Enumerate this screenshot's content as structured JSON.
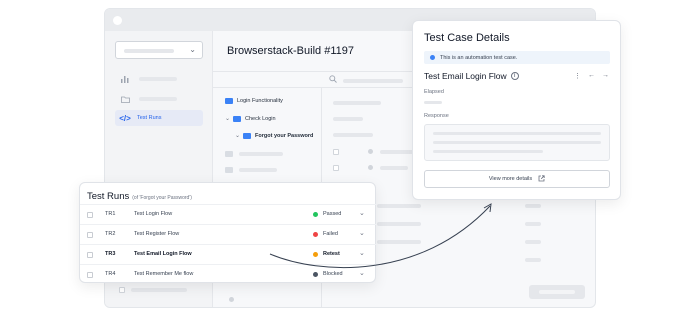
{
  "app": {
    "build_title": "Browserstack-Build #1197",
    "nav": [
      {
        "icon": "chart-icon",
        "label": ""
      },
      {
        "icon": "folder-icon",
        "label": ""
      },
      {
        "icon": "code-icon",
        "label": "Test Runs",
        "active": true
      }
    ],
    "tree": [
      {
        "label": "Login Functionality",
        "level": 0,
        "bold": false
      },
      {
        "label": "Check Login",
        "level": 1,
        "bold": false
      },
      {
        "label": "Forgot your Password",
        "level": 2,
        "bold": true
      }
    ]
  },
  "details": {
    "title": "Test Case Details",
    "banner": "This is an automation test case.",
    "case_name": "Test Email Login Flow",
    "elapsed_label": "Elapsed",
    "response_label": "Response",
    "more_button": "View more details"
  },
  "runs": {
    "title": "Test Runs",
    "subtitle": "(of 'Forgot your Password')",
    "rows": [
      {
        "id": "TR1",
        "name": "Test Login Flow",
        "status": "Passed",
        "color": "#22c55e",
        "bold": false
      },
      {
        "id": "TR2",
        "name": "Test Register Flow",
        "status": "Failed",
        "color": "#ef4444",
        "bold": false
      },
      {
        "id": "TR3",
        "name": "Test Email Login Flow",
        "status": "Retest",
        "color": "#f59e0b",
        "bold": true
      },
      {
        "id": "TR4",
        "name": "Test Remember Me flow",
        "status": "Blocked",
        "color": "#4b5563",
        "bold": false
      }
    ]
  }
}
